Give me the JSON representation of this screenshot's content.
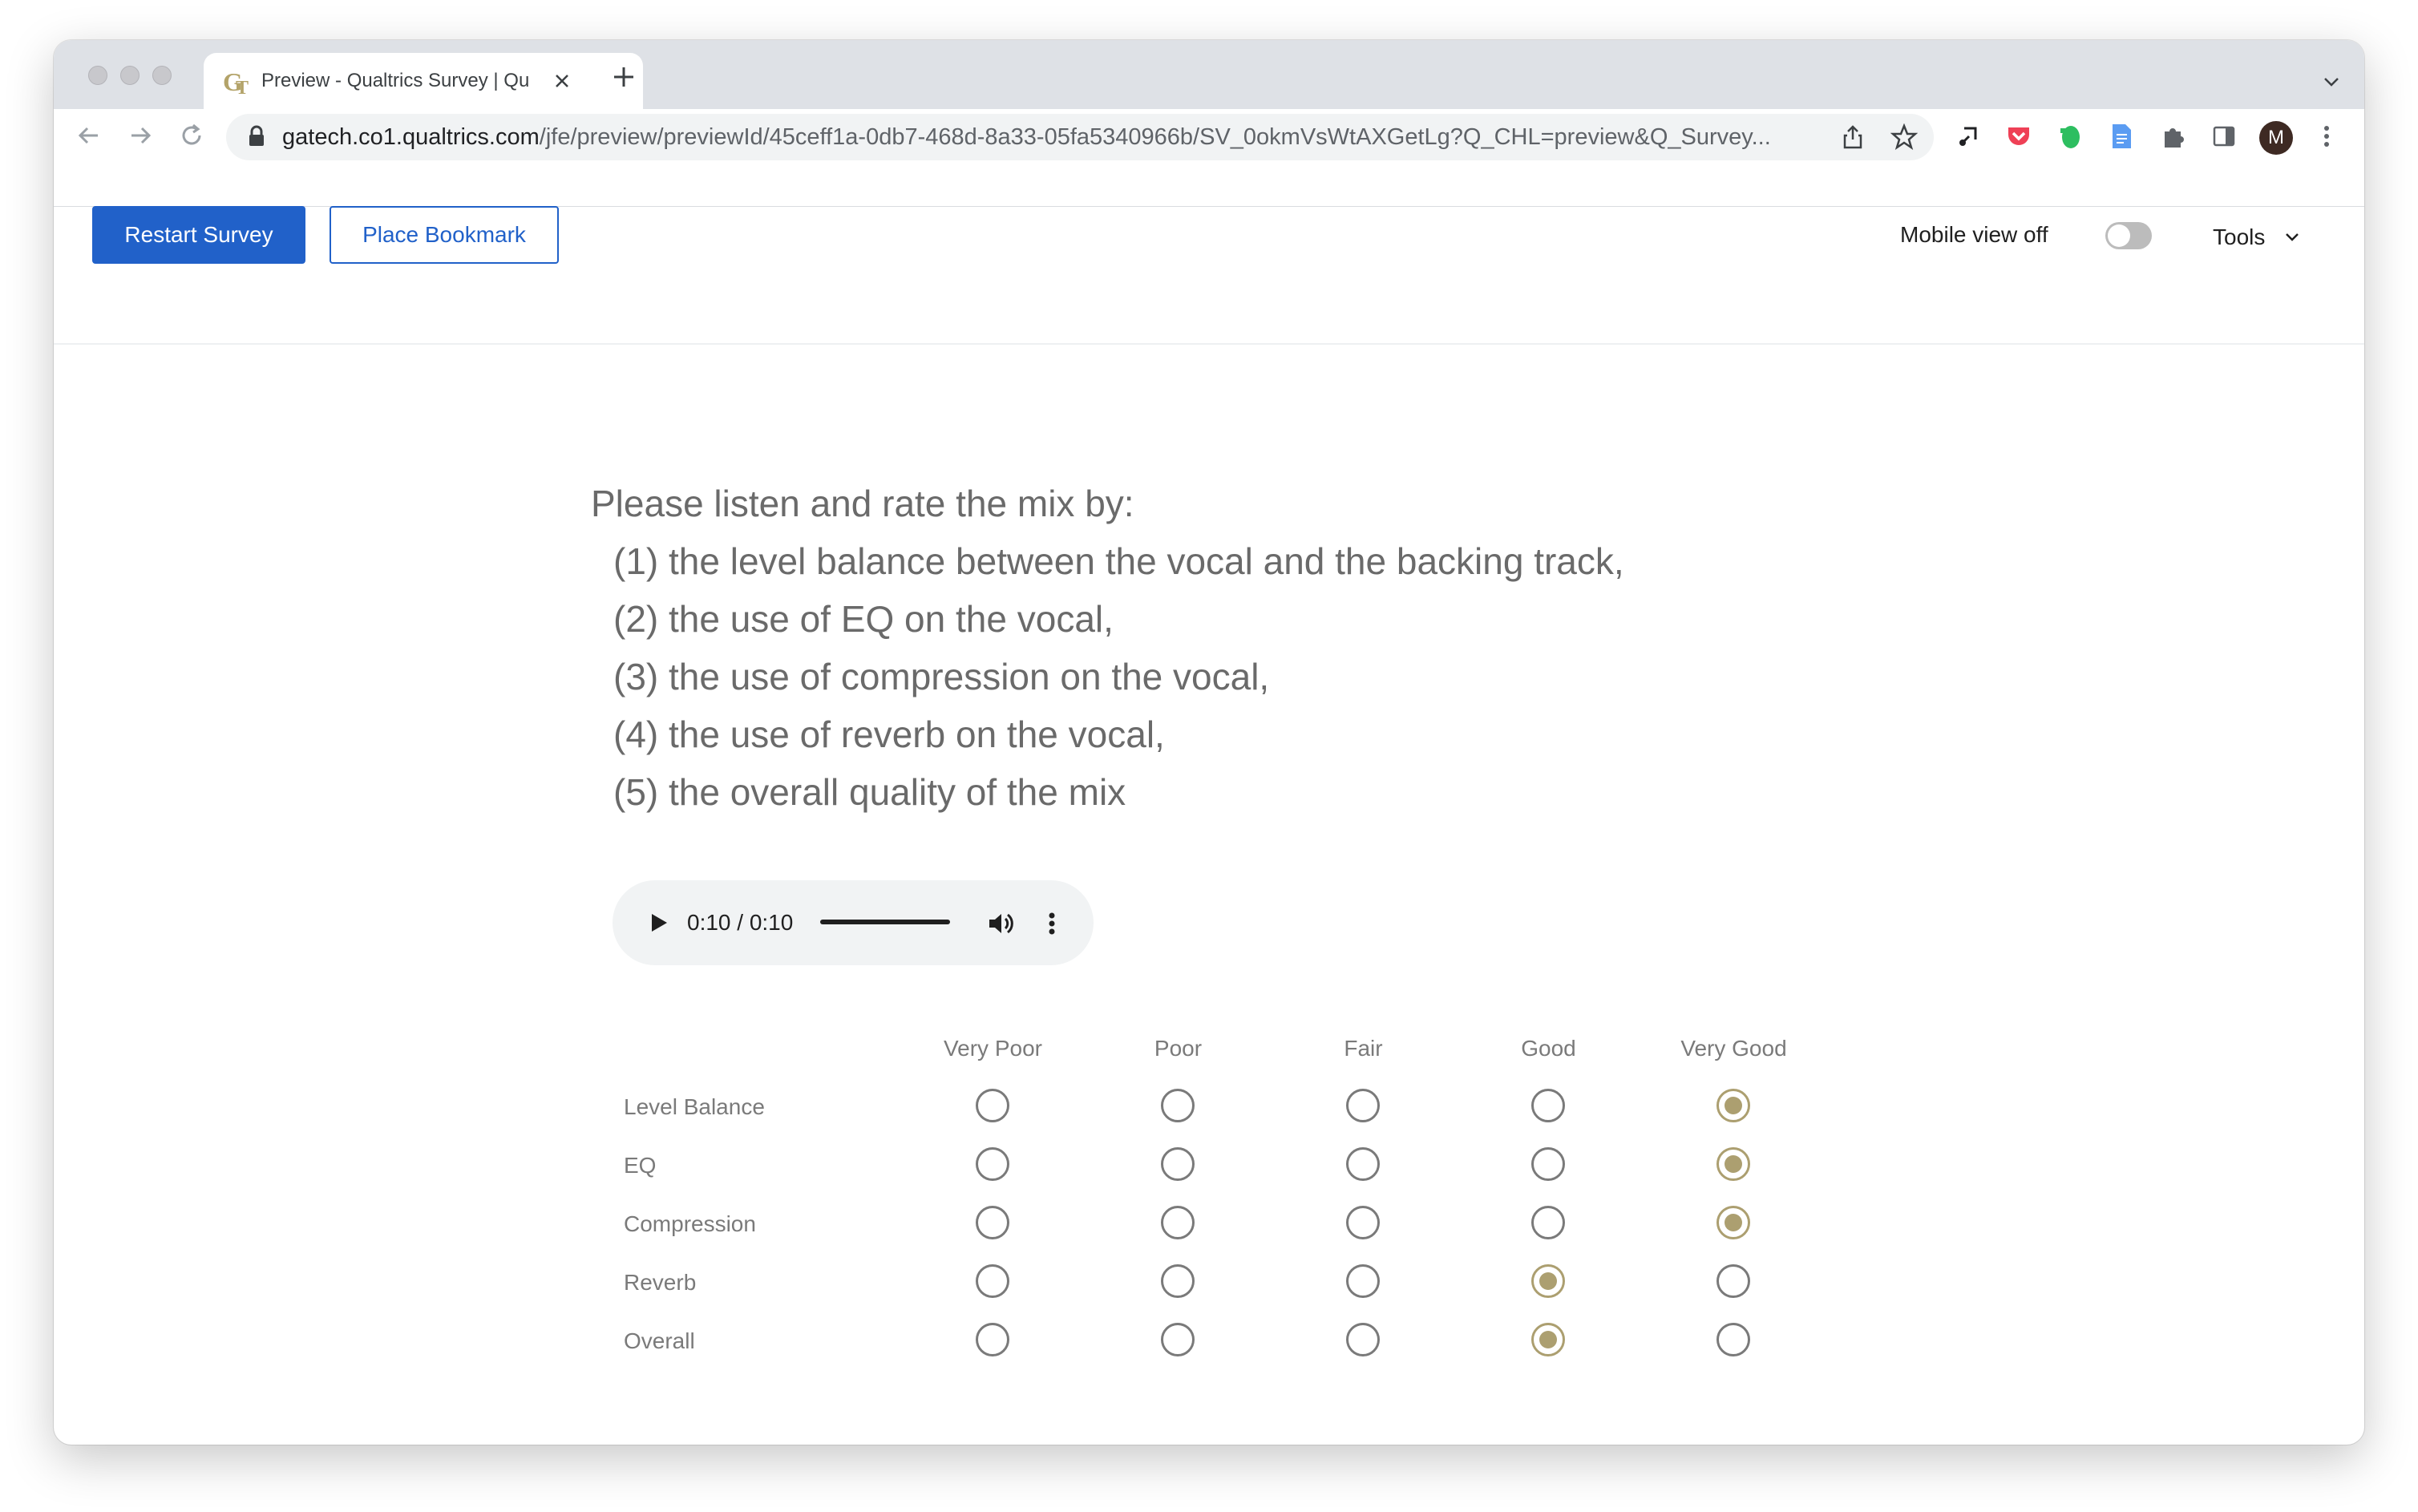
{
  "browser": {
    "tab_title": "Preview - Qualtrics Survey | Qu",
    "url_host": "gatech.co1.qualtrics.com",
    "url_path": "/jfe/preview/previewId/45ceff1a-0db7-468d-8a33-05fa5340966b/SV_0okmVsWtAXGetLg?Q_CHL=preview&Q_Survey...",
    "profile_initial": "M",
    "icons": [
      "back-icon",
      "forward-icon",
      "reload-icon",
      "lock-icon",
      "share-icon",
      "star-icon",
      "extension-icon",
      "pocket-icon",
      "evernote-icon",
      "docs-icon",
      "puzzle-icon",
      "sidepanel-icon",
      "kebab-menu-icon"
    ]
  },
  "preview_bar": {
    "restart_label": "Restart Survey",
    "bookmark_label": "Place Bookmark",
    "mobile_view_label": "Mobile view off",
    "mobile_view_on": false,
    "tools_label": "Tools"
  },
  "question": {
    "intro": "Please listen and rate the mix by:",
    "items": [
      "(1) the level balance between the vocal and the backing track,",
      "(2) the use of EQ on the vocal,",
      "(3) the use of compression on the vocal,",
      "(4) the use of reverb on the vocal,",
      "(5) the overall quality of the mix"
    ]
  },
  "audio": {
    "time": "0:10 / 0:10",
    "progress": 1.0
  },
  "matrix": {
    "columns": [
      "Very Poor",
      "Poor",
      "Fair",
      "Good",
      "Very Good"
    ],
    "rows": [
      {
        "label": "Level Balance",
        "selected": "Very Good"
      },
      {
        "label": "EQ",
        "selected": "Very Good"
      },
      {
        "label": "Compression",
        "selected": "Very Good"
      },
      {
        "label": "Reverb",
        "selected": "Good"
      },
      {
        "label": "Overall",
        "selected": "Good"
      }
    ],
    "accent_color": "#ac9f70"
  },
  "colors": {
    "primary_button": "#2161c9",
    "question_text": "#6a6a6a",
    "label_text": "#7a7a7a"
  }
}
